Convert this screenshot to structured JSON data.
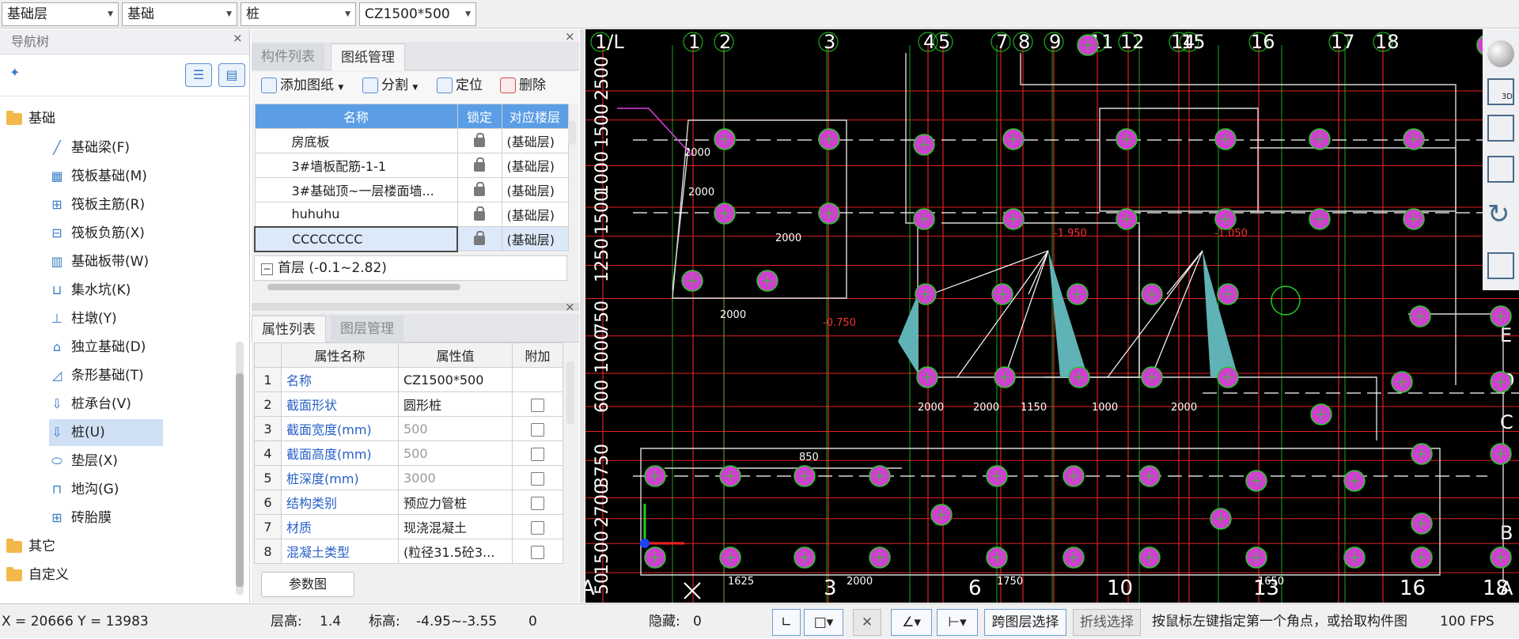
{
  "toolbar_top": {
    "floor_select": "基础层",
    "type_select": "基础",
    "element_select": "桩",
    "name_select": "CZ1500*500"
  },
  "nav": {
    "title": "导航树",
    "close": "×",
    "root": "基础",
    "items": [
      {
        "label": "基础梁(F)",
        "icon": "beam-icon",
        "glyph": "╱"
      },
      {
        "label": "筏板基础(M)",
        "icon": "raft-icon",
        "glyph": "▦"
      },
      {
        "label": "筏板主筋(R)",
        "icon": "raft-main-rebar-icon",
        "glyph": "⊞"
      },
      {
        "label": "筏板负筋(X)",
        "icon": "raft-neg-rebar-icon",
        "glyph": "⊟"
      },
      {
        "label": "基础板带(W)",
        "icon": "strip-icon",
        "glyph": "▥"
      },
      {
        "label": "集水坑(K)",
        "icon": "sump-icon",
        "glyph": "⊔"
      },
      {
        "label": "柱墩(Y)",
        "icon": "pier-icon",
        "glyph": "⊥"
      },
      {
        "label": "独立基础(D)",
        "icon": "isolated-footing-icon",
        "glyph": "⌂"
      },
      {
        "label": "条形基础(T)",
        "icon": "strip-footing-icon",
        "glyph": "◿"
      },
      {
        "label": "桩承台(V)",
        "icon": "pile-cap-icon",
        "glyph": "⇩"
      },
      {
        "label": "桩(U)",
        "icon": "pile-icon",
        "glyph": "⇩"
      },
      {
        "label": "垫层(X)",
        "icon": "cushion-icon",
        "glyph": "⬭"
      },
      {
        "label": "地沟(G)",
        "icon": "trench-icon",
        "glyph": "⊓"
      },
      {
        "label": "砖胎膜",
        "icon": "brick-mold-icon",
        "glyph": "⊞"
      }
    ],
    "others": "其它",
    "custom": "自定义"
  },
  "drawings": {
    "tab_component": "构件列表",
    "tab_drawing": "图纸管理",
    "add_drawing": "添加图纸",
    "split": "分割",
    "locate": "定位",
    "delete": "删除",
    "headers": [
      "名称",
      "锁定",
      "对应楼层"
    ],
    "rows": [
      {
        "name": "房底板",
        "floor": "(基础层)"
      },
      {
        "name": "3#墙板配筋-1-1",
        "floor": "(基础层)"
      },
      {
        "name": "3#基础顶~一层楼面墙...",
        "floor": "(基础层)"
      },
      {
        "name": "huhuhu",
        "floor": "(基础层)"
      },
      {
        "name": "CCCCCCCC",
        "floor": "(基础层)"
      }
    ],
    "group_row": "首层 (-0.1~2.82)"
  },
  "attributes": {
    "tab_props": "属性列表",
    "tab_layers": "图层管理",
    "headers": [
      "属性名称",
      "属性值",
      "附加"
    ],
    "rows": [
      {
        "n": "1",
        "name": "名称",
        "value": "CZ1500*500",
        "check": false
      },
      {
        "n": "2",
        "name": "截面形状",
        "value": "圆形桩",
        "check": true
      },
      {
        "n": "3",
        "name": "截面宽度(mm)",
        "value": "500",
        "check": true
      },
      {
        "n": "4",
        "name": "截面高度(mm)",
        "value": "500",
        "check": true
      },
      {
        "n": "5",
        "name": "桩深度(mm)",
        "value": "3000",
        "check": true
      },
      {
        "n": "6",
        "name": "结构类别",
        "value": "预应力管桩",
        "check": true
      },
      {
        "n": "7",
        "name": "材质",
        "value": "现浇混凝土",
        "check": true
      },
      {
        "n": "8",
        "name": "混凝土类型",
        "value": "(粒径31.5砼3...",
        "check": true
      }
    ],
    "param_button": "参数图"
  },
  "canvas": {
    "top_axis": [
      "1/L",
      "1",
      "2",
      "3",
      "4",
      "5",
      "7",
      "8",
      "9",
      "11",
      "12",
      "14",
      "15",
      "16",
      "17",
      "18"
    ],
    "bottom_axis": [
      "A",
      "3",
      "6",
      "10",
      "13",
      "16",
      "18"
    ],
    "left_dims": [
      "2500",
      "1500",
      "1000",
      "1500",
      "1250",
      "750",
      "1000",
      "600",
      "3750",
      "2700",
      "1500",
      "50"
    ],
    "right_axis": [
      "E",
      "D",
      "C",
      "B",
      "A"
    ],
    "dims": [
      "2000",
      "2000",
      "2000",
      "2000",
      "850",
      "2000",
      "2000",
      "1150",
      "1000",
      "2000",
      "1625",
      "2000",
      "1750",
      "1650"
    ],
    "elev1": "-1.950",
    "elev2": "-0.750",
    "elev3": "-1.050"
  },
  "status": {
    "coords": "X = 20666 Y = 13983",
    "floor_height_label": "层高:",
    "floor_height": "1.4",
    "elev_label": "标高:",
    "elev": "-4.95~-3.55",
    "zero": "0",
    "hidden_label": "隐藏:",
    "hidden": "0",
    "cross_layer": "跨图层选择",
    "polyline": "折线选择",
    "hint": "按鼠标左键指定第一个角点，或拾取构件图",
    "fps": "100 FPS"
  },
  "colors": {
    "accent": "#5b9ee6",
    "canvas_bg": "#000000",
    "grid_red": "#e02020",
    "grid_green": "#22cc22",
    "pile_magenta": "#d040d0"
  }
}
